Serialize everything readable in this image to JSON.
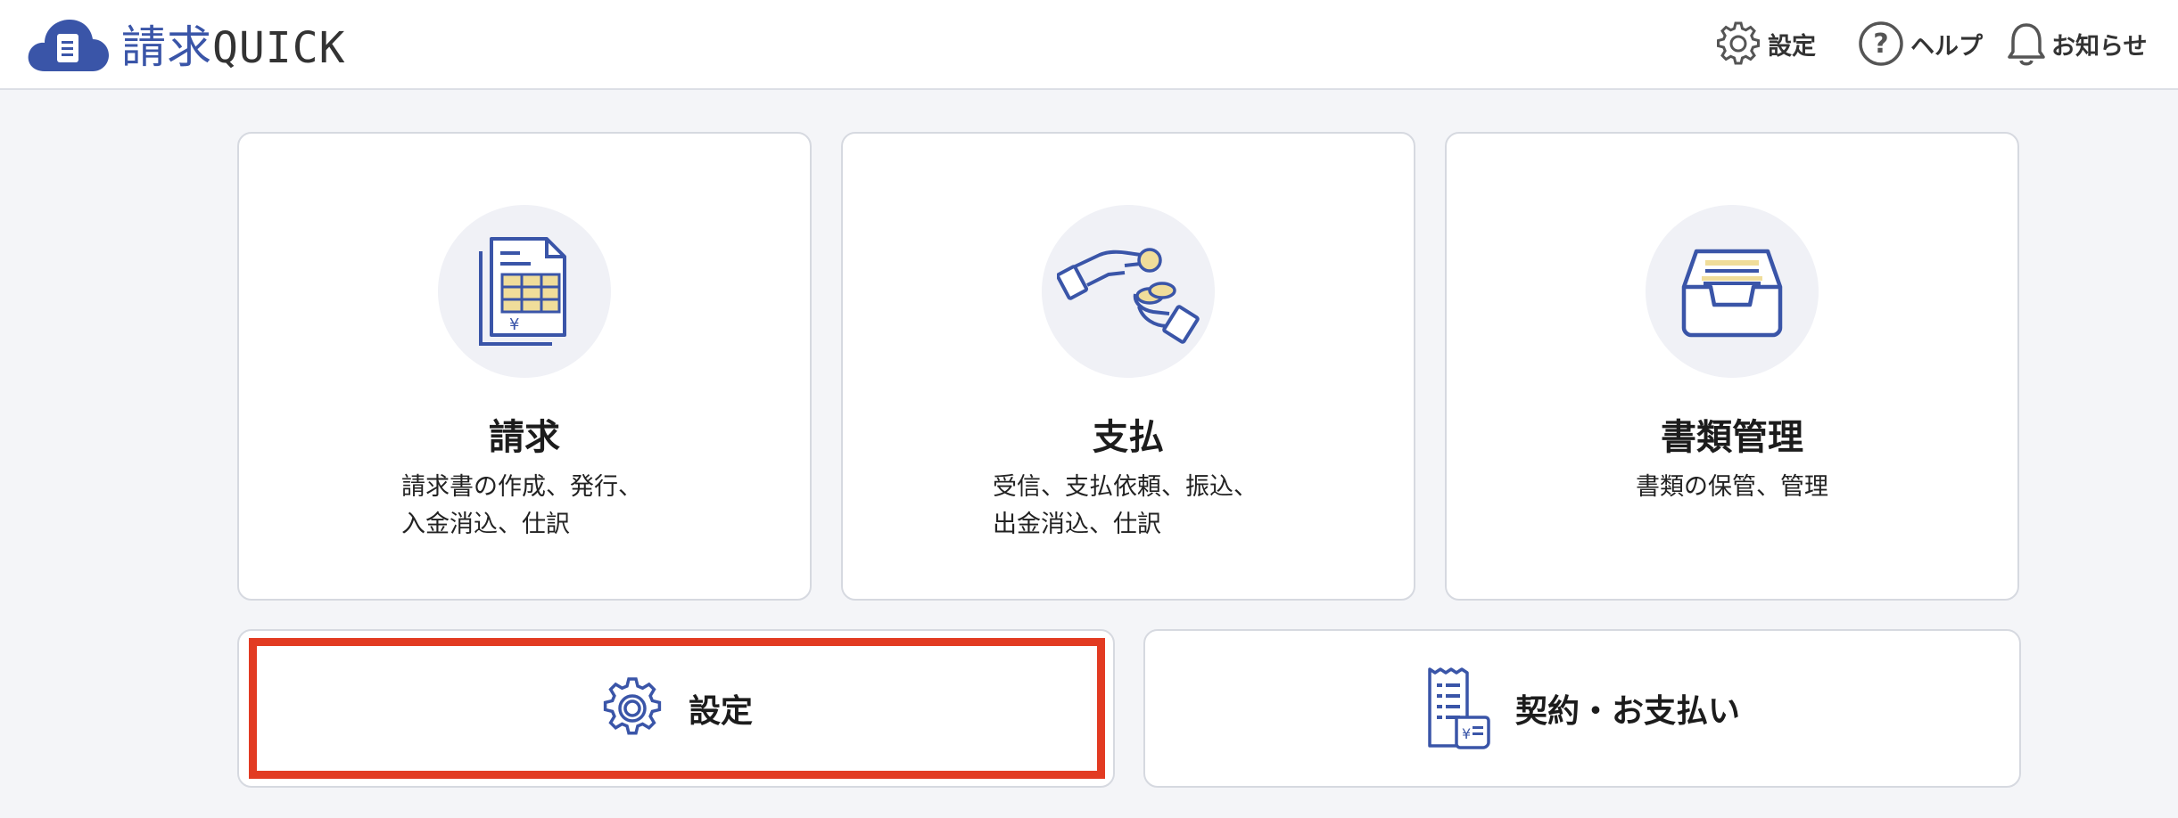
{
  "header": {
    "logo_text_main": "請求",
    "logo_text_sub": "QUICK",
    "nav": [
      {
        "label": "設定",
        "icon": "gear-icon"
      },
      {
        "label": "ヘルプ",
        "icon": "help-icon"
      },
      {
        "label": "お知らせ",
        "icon": "bell-icon"
      }
    ]
  },
  "cards": [
    {
      "title": "請求",
      "desc_line1": "請求書の作成、発行、",
      "desc_line2": "入金消込、仕訳",
      "icon": "invoice-icon"
    },
    {
      "title": "支払",
      "desc_line1": "受信、支払依頼、振込、",
      "desc_line2": "出金消込、仕訳",
      "icon": "payment-hands-icon"
    },
    {
      "title": "書類管理",
      "desc_line1": "書類の保管、管理",
      "icon": "document-tray-icon"
    }
  ],
  "bottom": [
    {
      "label": "設定",
      "icon": "gear-icon",
      "highlighted": true
    },
    {
      "label": "契約・お支払い",
      "icon": "receipt-icon"
    }
  ],
  "colors": {
    "accent": "#3a55a8",
    "highlight": "#e23b22",
    "icon_fill": "#f0dd9a",
    "background": "#f4f5f8"
  }
}
